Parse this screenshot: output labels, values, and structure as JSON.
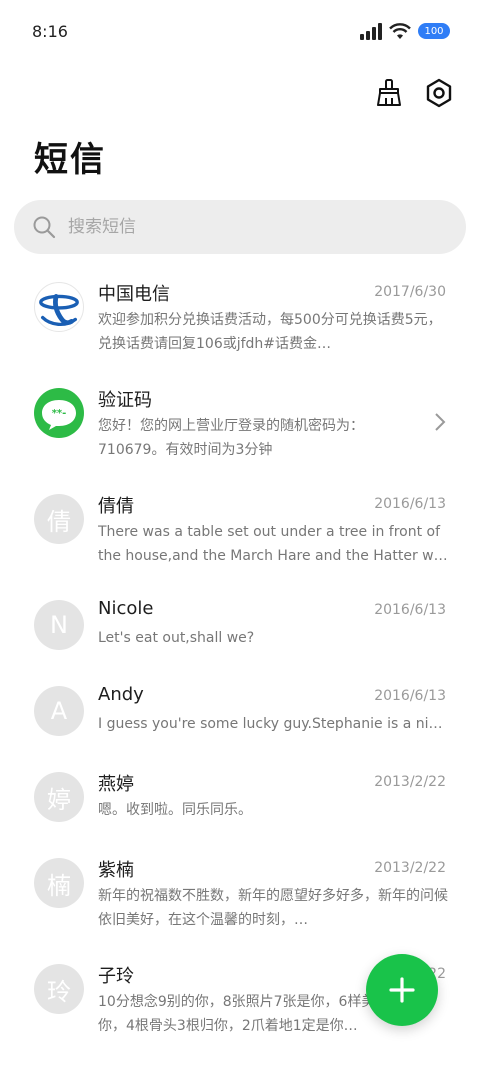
{
  "status": {
    "time": "8:16",
    "battery": "100"
  },
  "title": "短信",
  "search": {
    "placeholder": "搜索短信"
  },
  "conversations": [
    {
      "name": "中国电信",
      "date": "2017/6/30",
      "preview": "欢迎参加积分兑换话费活动，每500分可兑换话费5元，兑换话费请回复106或jfdh#话费金…",
      "avatar": "china-telecom-logo"
    },
    {
      "name": "验证码",
      "date": "",
      "preview": "您好！您的网上营业厅登录的随机密码为：710679。有效时间为3分钟",
      "avatar": "message-icon"
    },
    {
      "name": "倩倩",
      "date": "2016/6/13",
      "preview": "There was a table set out under a tree in front of the house,and the March Hare and the Hatter w…",
      "avatar_letter": "倩"
    },
    {
      "name": "Nicole",
      "date": "2016/6/13",
      "preview": "Let's eat out,shall we?",
      "avatar_letter": "N"
    },
    {
      "name": "Andy",
      "date": "2016/6/13",
      "preview": "I guess you're some lucky guy.Stephanie is a nice girl.",
      "avatar_letter": "A"
    },
    {
      "name": "燕婷",
      "date": "2013/2/22",
      "preview": "嗯。收到啦。同乐同乐。",
      "avatar_letter": "婷"
    },
    {
      "name": "紫楠",
      "date": "2013/2/22",
      "preview": "新年的祝福数不胜数，新年的愿望好多好多，新年的问候依旧美好，在这个温馨的时刻，…",
      "avatar_letter": "楠"
    },
    {
      "name": "子玲",
      "date": "2013/2/22",
      "preview": "10分想念9别的你，8张照片7张是你，6样美好5只偏你，4根骨头3根归你，2爪着地1定是你…",
      "avatar_letter": "玲"
    }
  ],
  "colors": {
    "accent": "#19c34a",
    "telecom_blue": "#1a5fb4"
  }
}
